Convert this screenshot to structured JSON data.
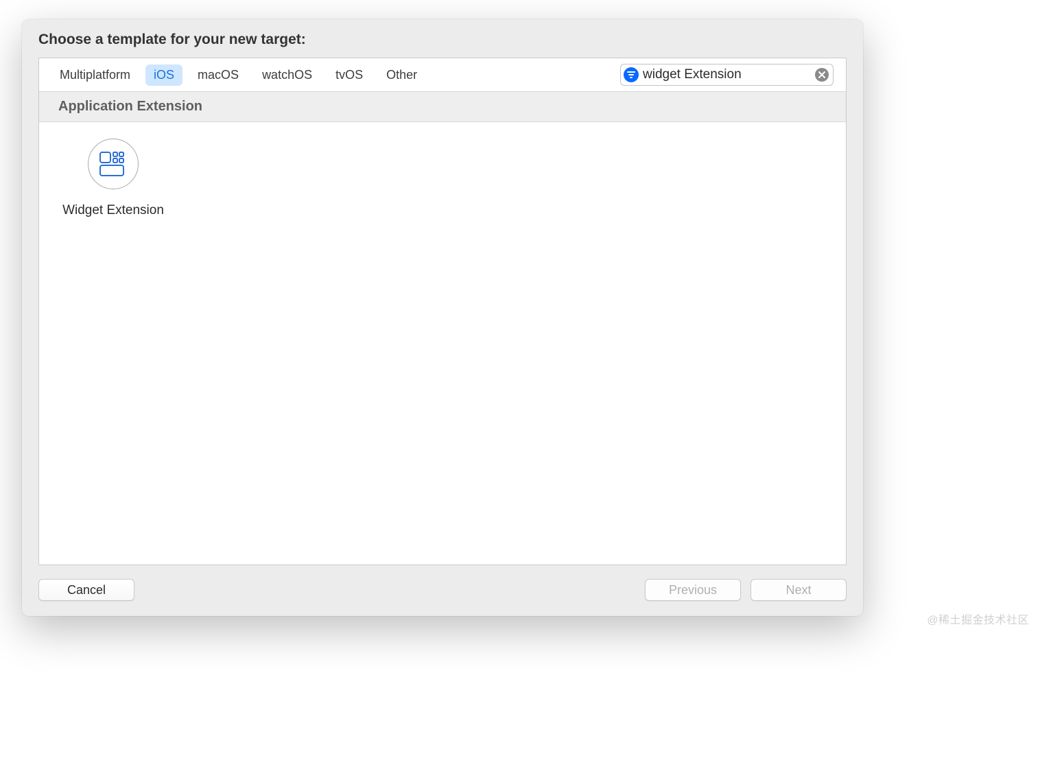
{
  "dialog": {
    "title": "Choose a template for your new target:"
  },
  "tabs": {
    "items": [
      "Multiplatform",
      "iOS",
      "macOS",
      "watchOS",
      "tvOS",
      "Other"
    ],
    "active_index": 1
  },
  "search": {
    "value": "widget Extension"
  },
  "section": {
    "header": "Application Extension"
  },
  "templates": {
    "items": [
      {
        "label": "Widget Extension",
        "icon": "widget-icon"
      }
    ]
  },
  "footer": {
    "cancel": "Cancel",
    "previous": "Previous",
    "next": "Next",
    "previous_enabled": false,
    "next_enabled": false
  },
  "watermark": "@稀土掘金技术社区"
}
